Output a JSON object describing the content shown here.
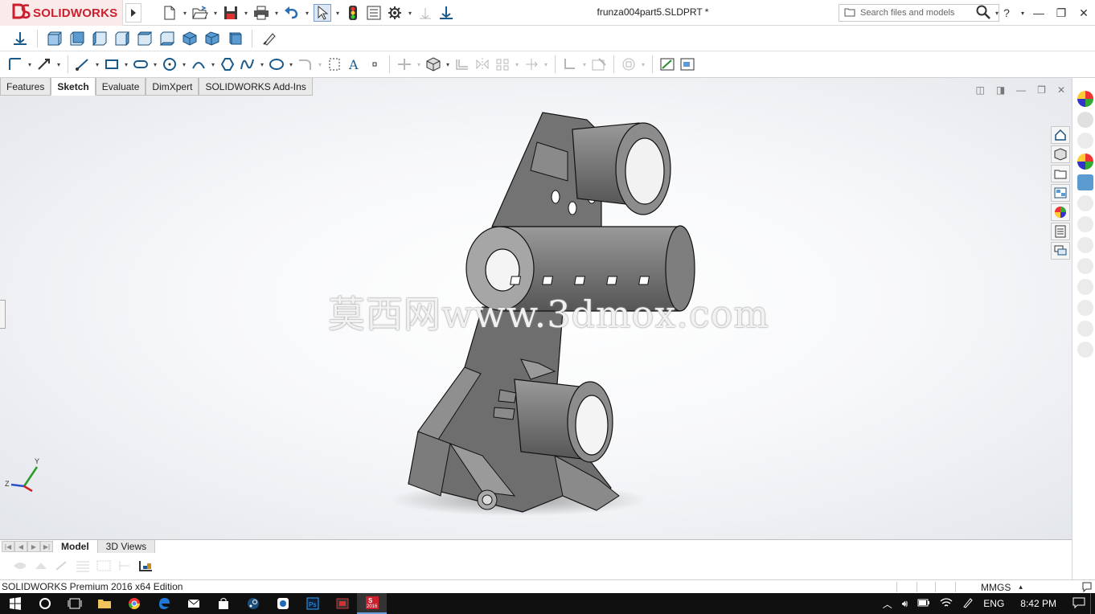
{
  "app": {
    "logo_prefix": "3S",
    "logo_brand": "SOLIDWORKS",
    "document_title": "frunza004part5.SLDPRT *",
    "search_placeholder": "Search files and models",
    "help_label": "?",
    "accent_color": "#cc1f2e"
  },
  "command_tabs": [
    {
      "label": "Features"
    },
    {
      "label": "Sketch"
    },
    {
      "label": "Evaluate"
    },
    {
      "label": "DimXpert"
    },
    {
      "label": "SOLIDWORKS Add-Ins"
    }
  ],
  "active_command_tab": "Sketch",
  "viewport": {
    "watermark": "莫西网www.3dmox.com",
    "triad_labels": {
      "x": "Z",
      "y": "Y"
    }
  },
  "bottom_tabs": [
    {
      "label": "Model"
    },
    {
      "label": "3D Views"
    }
  ],
  "status": {
    "edition": "SOLIDWORKS Premium 2016 x64 Edition",
    "units": "MMGS",
    "units_arrow": "▴"
  },
  "taskbar": {
    "language": "ENG",
    "clock": "8:42 PM",
    "sw_badge": "2016"
  },
  "icons": {
    "title_toolbar": [
      "new-icon",
      "open-icon",
      "save-icon",
      "print-icon",
      "undo-icon",
      "select-icon",
      "rebuild-icon",
      "file-properties-icon",
      "options-icon",
      "plane-icon",
      "reference-icon"
    ],
    "view_strip": [
      "home-icon",
      "parts-icon",
      "folder-icon",
      "view-palette-icon",
      "appearances-icon",
      "custom-properties-icon",
      "forum-icon"
    ]
  }
}
